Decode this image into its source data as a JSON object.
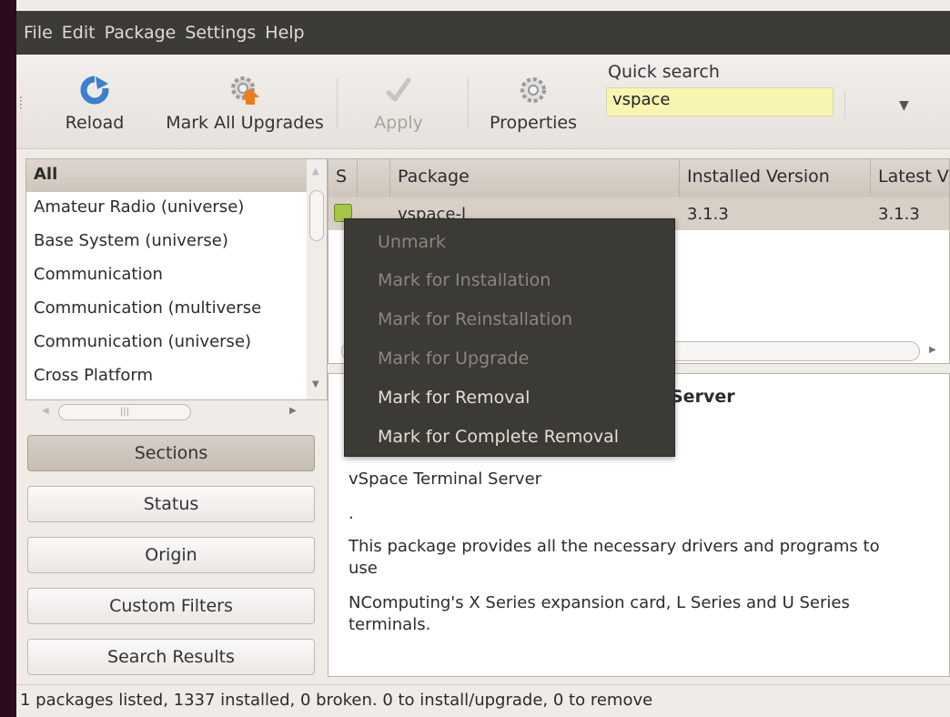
{
  "menubar": {
    "items": [
      "File",
      "Edit",
      "Package",
      "Settings",
      "Help"
    ]
  },
  "toolbar": {
    "reload_label": "Reload",
    "mark_all_upgrades_label": "Mark All Upgrades",
    "apply_label": "Apply",
    "properties_label": "Properties",
    "quick_search_label": "Quick search",
    "quick_search_value": "vspace",
    "overflow_arrow": "▼"
  },
  "sections": {
    "header": "All",
    "items": [
      "Amateur Radio (universe)",
      "Base System (universe)",
      "Communication",
      "Communication (multiverse",
      "Communication (universe)",
      "Cross Platform"
    ]
  },
  "filter_buttons": {
    "sections": "Sections",
    "status": "Status",
    "origin": "Origin",
    "custom_filters": "Custom Filters",
    "search_results": "Search Results"
  },
  "package_table": {
    "columns": [
      "S",
      "Package",
      "Installed Version",
      "Latest V"
    ],
    "rows": [
      {
        "package": "vspace-l",
        "installed_version": "3.1.3",
        "latest_version": "3.1.3"
      }
    ]
  },
  "context_menu": {
    "items": [
      {
        "label": "Unmark",
        "enabled": false
      },
      {
        "label": "Mark for Installation",
        "enabled": false
      },
      {
        "label": "Mark for Reinstallation",
        "enabled": false
      },
      {
        "label": "Mark for Upgrade",
        "enabled": false
      },
      {
        "label": "Mark for Removal",
        "enabled": true
      },
      {
        "label": "Mark for Complete Removal",
        "enabled": true
      }
    ]
  },
  "description": {
    "title": "Server",
    "line1": "vSpace Terminal Server",
    "line2": ".",
    "line3": " This package provides all the necessary drivers and programs to use",
    "line4": "NComputing's X Series expansion card, L Series and U Series terminals."
  },
  "statusbar": {
    "text": "1 packages listed, 1337 installed, 0 broken. 0 to install/upgrade, 0 to remove"
  },
  "colors": {
    "menubar_bg": "#3c3b37",
    "context_menu_bg": "#3b3a35",
    "search_field_bg": "#f8f5b0",
    "status_check": "#a5c64a"
  }
}
